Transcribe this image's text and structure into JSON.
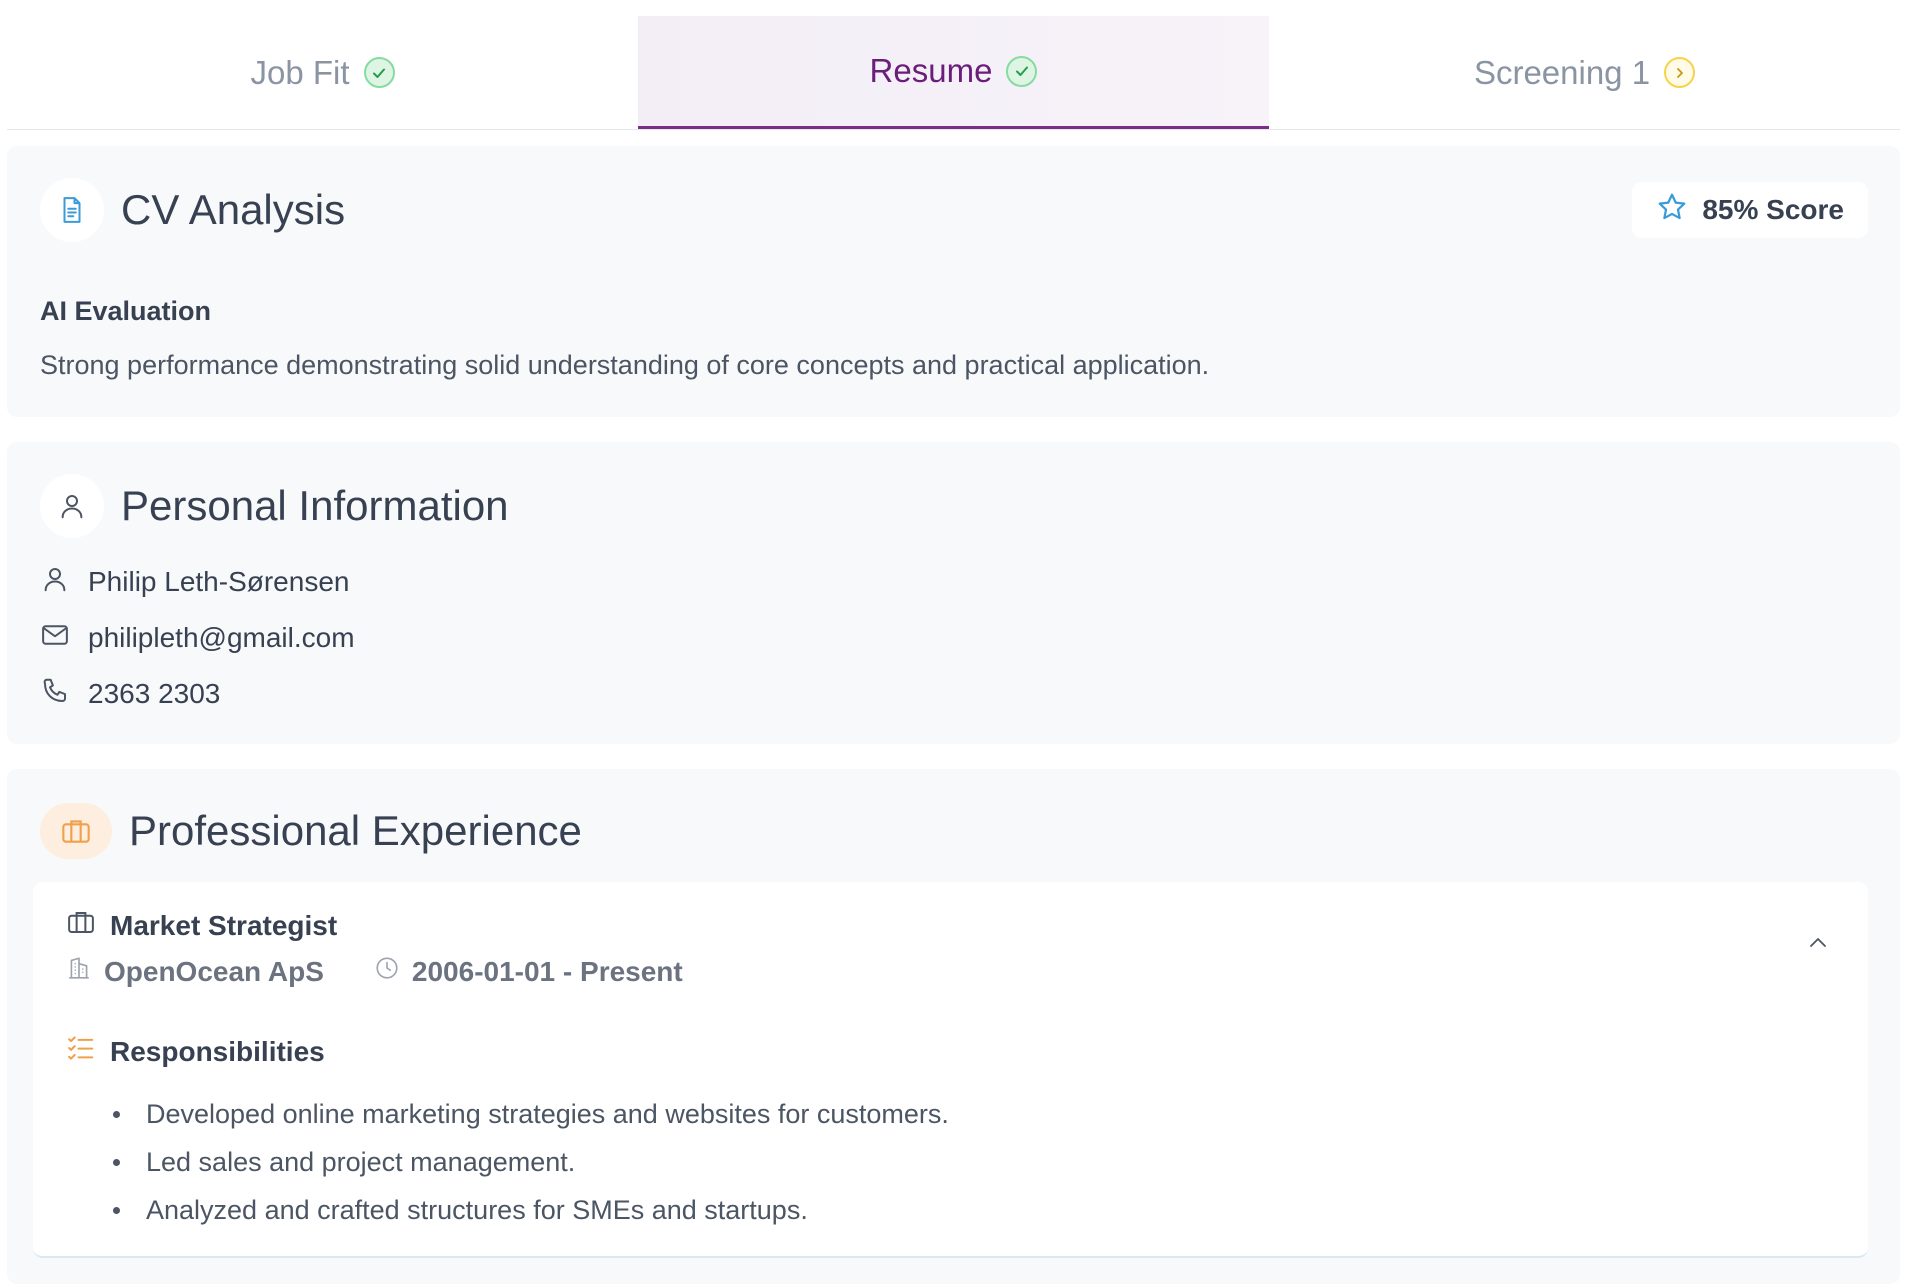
{
  "tabs": [
    {
      "label": "Job Fit",
      "status": "done",
      "active": false
    },
    {
      "label": "Resume",
      "status": "done",
      "active": true
    },
    {
      "label": "Screening 1",
      "status": "pending",
      "active": false
    }
  ],
  "cv_analysis": {
    "title": "CV Analysis",
    "score_label": "85% Score",
    "eval_heading": "AI Evaluation",
    "eval_text": "Strong performance demonstrating solid understanding of core concepts and practical application."
  },
  "personal": {
    "title": "Personal Information",
    "name": "Philip Leth-Sørensen",
    "email": "philipleth@gmail.com",
    "phone": "2363 2303"
  },
  "experience": {
    "title": "Professional Experience",
    "items": [
      {
        "role": "Market Strategist",
        "company": "OpenOcean ApS",
        "period": "2006-01-01 - Present",
        "responsibilities_heading": "Responsibilities",
        "responsibilities": [
          "Developed online marketing strategies and websites for customers.",
          "Led sales and project management.",
          "Analyzed and crafted structures for SMEs and startups."
        ]
      }
    ]
  },
  "colors": {
    "accent": "#6b1d7a",
    "success": "#22c55e",
    "pending": "#eab308",
    "info_blue": "#3b9bd6",
    "orange": "#f0a04b"
  },
  "icons": {
    "tab_done": "check-icon",
    "tab_pending": "chevron-right-icon",
    "cv": "document-icon",
    "score": "star-icon",
    "personal": "user-icon",
    "name": "user-icon",
    "email": "mail-icon",
    "phone": "phone-icon",
    "experience": "briefcase-icon",
    "role": "briefcase-icon",
    "company": "building-icon",
    "period": "clock-icon",
    "responsibilities": "list-check-icon",
    "collapse": "chevron-up-icon"
  }
}
